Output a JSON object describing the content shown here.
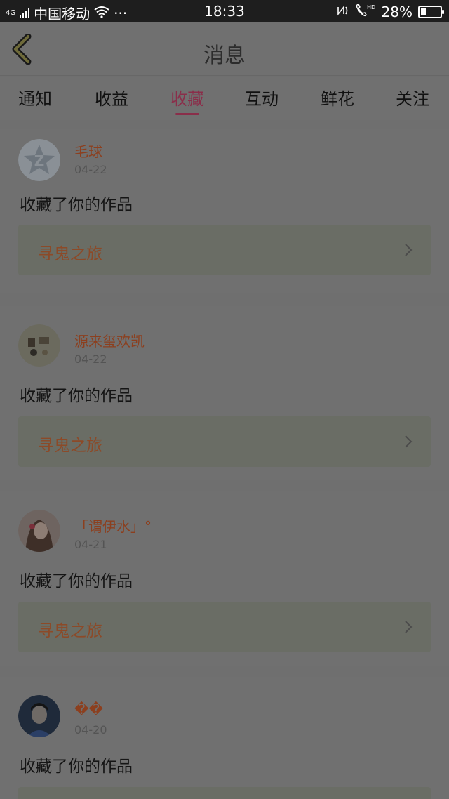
{
  "status_bar": {
    "network_badge": "4G",
    "carrier": "中国移动",
    "more": "···",
    "time": "18:33",
    "battery_percent": "28%",
    "battery_level": 0.28
  },
  "header": {
    "title": "消息"
  },
  "tabs": [
    {
      "label": "通知",
      "active": false
    },
    {
      "label": "收益",
      "active": false
    },
    {
      "label": "收藏",
      "active": true
    },
    {
      "label": "互动",
      "active": false
    },
    {
      "label": "鲜花",
      "active": false
    },
    {
      "label": "关注",
      "active": false
    }
  ],
  "messages": [
    {
      "username": "毛球",
      "date": "04-22",
      "action": "收藏了你的作品",
      "work_title": "寻鬼之旅"
    },
    {
      "username": "源来玺欢凯",
      "date": "04-22",
      "action": "收藏了你的作品",
      "work_title": "寻鬼之旅"
    },
    {
      "username": "「谓伊水」°",
      "date": "04-21",
      "action": "收藏了你的作品",
      "work_title": "寻鬼之旅"
    },
    {
      "username": "��",
      "date": "04-20",
      "action": "收藏了你的作品",
      "work_title": ""
    }
  ],
  "colors": {
    "accent": "#8a2e4a",
    "username": "#8c3f1e",
    "work_title": "#8c4a28",
    "overlay_background": "#6f6f6f"
  }
}
